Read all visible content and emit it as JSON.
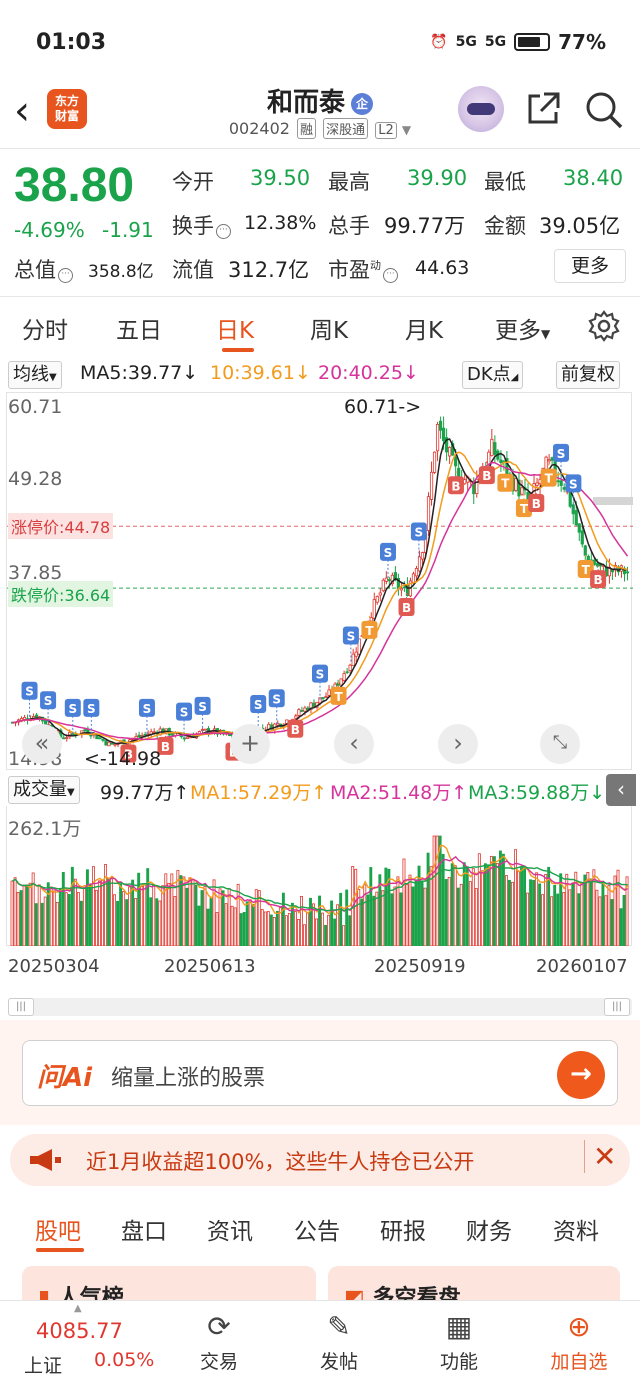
{
  "status_bar": {
    "time": "01:03",
    "battery": "77%",
    "battery_level": 0.77,
    "signal1": "5G",
    "signal2": "5G"
  },
  "header": {
    "logo_text": "东方财富",
    "stock_name": "和而泰",
    "badge": "企",
    "stock_code": "002402",
    "tags": [
      "融",
      "深股通",
      "L2"
    ]
  },
  "quote": {
    "price": "38.80",
    "change_pct": "-4.69%",
    "change": "-1.91",
    "open_label": "今开",
    "open": "39.50",
    "high_label": "最高",
    "high": "39.90",
    "low_label": "最低",
    "low": "38.40",
    "turnover_label": "换手",
    "turnover": "12.38%",
    "volume_label": "总手",
    "volume": "99.77万",
    "amount_label": "金额",
    "amount": "39.05亿",
    "mcap_label": "总值",
    "mcap": "358.8亿",
    "float_label": "流值",
    "float": "312.7亿",
    "pe_label": "市盈",
    "pe_sup": "动",
    "pe": "44.63",
    "more": "更多"
  },
  "period_tabs": [
    "分时",
    "五日",
    "日K",
    "周K",
    "月K",
    "更多"
  ],
  "ma_row": {
    "selector": "均线",
    "ma5": "MA5:39.77",
    "ma10": "10:39.61",
    "ma20": "20:40.25",
    "dk": "DK点",
    "adjust": "前复权",
    "colors": {
      "ma5": "#222222",
      "ma10": "#f29b1d",
      "ma20": "#d6339b"
    }
  },
  "chart_labels": {
    "y_top": "60.71",
    "y_mid": "49.28",
    "y_low": "37.85",
    "y_bottom": "14.98",
    "max_note": "60.71->",
    "min_note": "<-14.98",
    "limit_up": "涨停价:44.78",
    "limit_down": "跌停价:36.64"
  },
  "volume_row": {
    "selector": "成交量",
    "vol": "99.77万",
    "ma1": "MA1:57.29万",
    "ma2": "MA2:51.48万",
    "ma3": "MA3:59.88万",
    "y_top": "262.1万"
  },
  "dates": [
    "20250304",
    "20250613",
    "20250919",
    "20260107"
  ],
  "chart_data": {
    "type": "candlestick",
    "ylim": [
      14.98,
      60.71
    ],
    "limit_up": 44.78,
    "limit_down": 36.64,
    "approx_close_path": [
      [
        0,
        19
      ],
      [
        0.04,
        20
      ],
      [
        0.08,
        17
      ],
      [
        0.12,
        18
      ],
      [
        0.16,
        16
      ],
      [
        0.2,
        17
      ],
      [
        0.24,
        18
      ],
      [
        0.28,
        17
      ],
      [
        0.32,
        18
      ],
      [
        0.36,
        17
      ],
      [
        0.4,
        18
      ],
      [
        0.44,
        19
      ],
      [
        0.48,
        21
      ],
      [
        0.52,
        23
      ],
      [
        0.55,
        27
      ],
      [
        0.58,
        33
      ],
      [
        0.61,
        38
      ],
      [
        0.64,
        36
      ],
      [
        0.67,
        43
      ],
      [
        0.69,
        58
      ],
      [
        0.72,
        52
      ],
      [
        0.75,
        50
      ],
      [
        0.78,
        55
      ],
      [
        0.81,
        51
      ],
      [
        0.84,
        48
      ],
      [
        0.87,
        53
      ],
      [
        0.9,
        50
      ],
      [
        0.93,
        41
      ],
      [
        0.96,
        39
      ],
      [
        1.0,
        38.8
      ]
    ]
  },
  "ai": {
    "logo": "问Ai",
    "placeholder": "缩量上涨的股票"
  },
  "banner": {
    "text": "近1月收益超100%，这些牛人持仓已公开"
  },
  "bottom_tabs": [
    "股吧",
    "盘口",
    "资讯",
    "公告",
    "研报",
    "财务",
    "资料"
  ],
  "cards": [
    "人气榜",
    "多空看盘"
  ],
  "bottom_nav": {
    "index_value": "4085.77",
    "index_name": "上证",
    "index_pct": "0.05%",
    "items": [
      "交易",
      "发帖",
      "功能",
      "加自选"
    ]
  }
}
